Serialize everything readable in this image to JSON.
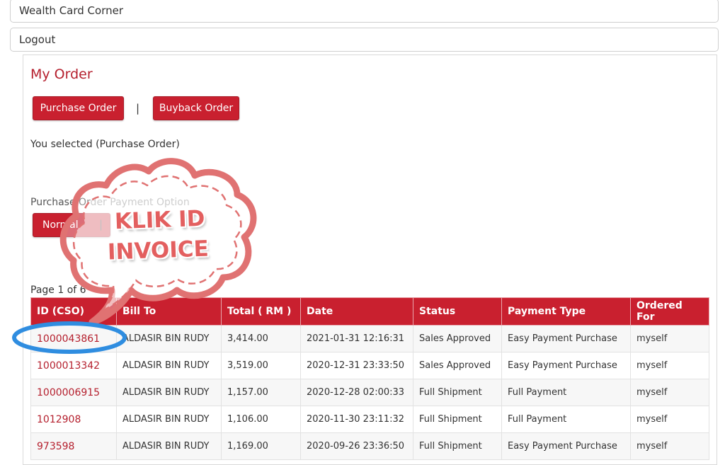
{
  "menu": {
    "wealth_card_corner": "Wealth Card Corner",
    "logout": "Logout"
  },
  "page": {
    "title": "My Order",
    "purchase_order_label": "Purchase Order",
    "separator": "|",
    "buyback_order_label": "Buyback Order",
    "selected_text": "You selected (Purchase Order)",
    "payment_option_title": "Purchase Order Payment Option",
    "normal_label": "Normal",
    "page_info": "Page 1 of 6"
  },
  "callout": {
    "line1": "KLIK ID",
    "line2": "INVOICE"
  },
  "table": {
    "headers": [
      "ID (CSO)",
      "Bill To",
      "Total ( RM )",
      "Date",
      "Status",
      "Payment Type",
      "Ordered For"
    ],
    "rows": [
      [
        "1000043861",
        "ALDASIR BIN RUDY",
        "3,414.00",
        "2021-01-31 12:16:31",
        "Sales Approved",
        "Easy Payment Purchase",
        "myself"
      ],
      [
        "1000013342",
        "ALDASIR BIN RUDY",
        "3,519.00",
        "2020-12-31 23:33:50",
        "Sales Approved",
        "Easy Payment Purchase",
        "myself"
      ],
      [
        "1000006915",
        "ALDASIR BIN RUDY",
        "1,157.00",
        "2020-12-28 02:00:33",
        "Full Shipment",
        "Full Payment",
        "myself"
      ],
      [
        "1012908",
        "ALDASIR BIN RUDY",
        "1,106.00",
        "2020-11-30 23:11:32",
        "Full Shipment",
        "Full Payment",
        "myself"
      ],
      [
        "973598",
        "ALDASIR BIN RUDY",
        "1,169.00",
        "2020-09-26 23:36:50",
        "Full Shipment",
        "Easy Payment Purchase",
        "myself"
      ]
    ]
  },
  "colors": {
    "brand_red": "#c9202f",
    "callout_pink": "#e35f5f",
    "highlight_blue": "#2f8de0"
  }
}
